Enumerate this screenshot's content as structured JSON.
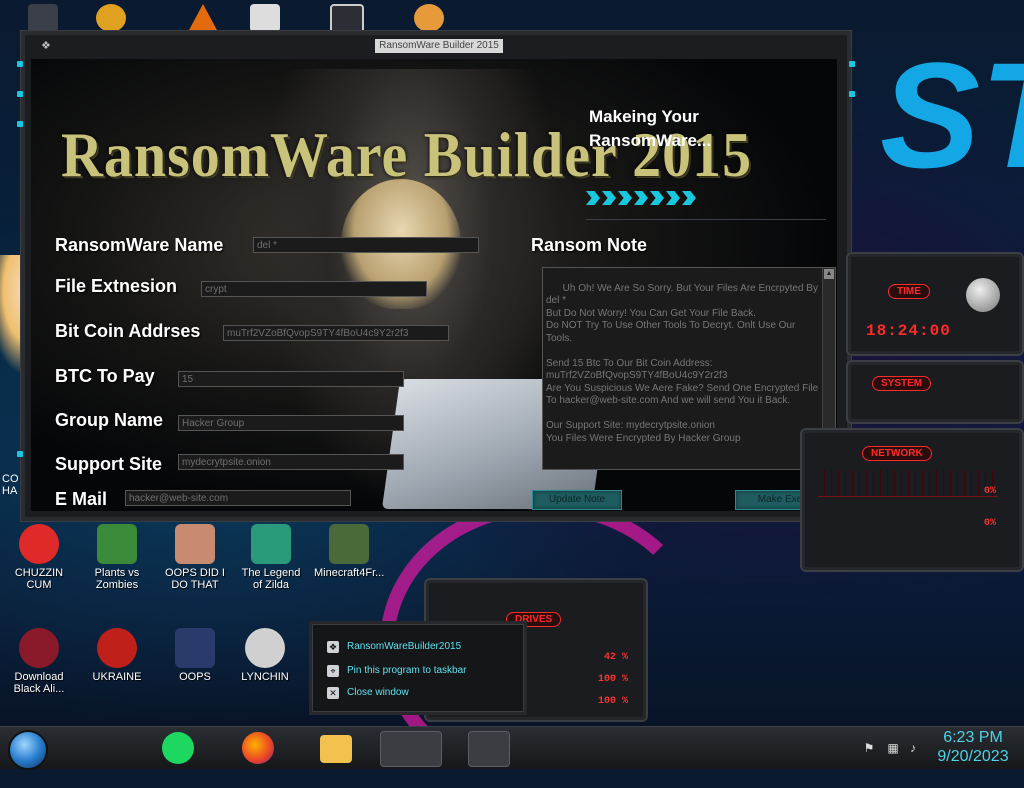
{
  "window": {
    "title": "RansomWare Builder 2015",
    "icon": "app-icon",
    "brand": "RansomWare Builder 2015",
    "status_line1": "Makeing Your",
    "status_line2": "RansomWare..."
  },
  "form": {
    "ransomware_name_label": "RansomWare Name",
    "ransomware_name_value": "del *",
    "file_extension_label": "File Extnesion",
    "file_extension_value": "crypt",
    "btc_address_label": "Bit Coin Addrses",
    "btc_address_value": "muTrf2VZoBfQvopS9TY4fBoU4c9Y2r2f3",
    "btc_pay_label": "BTC To Pay",
    "btc_pay_value": "15",
    "group_label": "Group Name",
    "group_value": "Hacker Group",
    "support_label": "Support Site",
    "support_value": "mydecrytpsite.onion",
    "email_label": "E Mail",
    "email_value": "hacker@web-site.com"
  },
  "note": {
    "label": "Ransom Note",
    "text": "Uh Oh! We Are So Sorry. But Your Files Are Encrpyted By del *\nBut Do Not Worry! You Can Get Your File Back.\nDo NOT Try To Use Other Tools To Decryt. Onlt Use Our Tools.\n\nSend 15 Btc To Our Bit Coin Address:\nmuTrf2VZoBfQvopS9TY4fBoU4c9Y2r2f3\nAre You Suspicious We Aere Fake? Send One Encrypted File To hacker@web-site.com And we will send You it Back.\n\nOur Support Site: mydecrytpsite.onion\nYou Files Were Encrypted By Hacker Group",
    "update_button": "Update Note",
    "make_button": "Make Exe"
  },
  "gadgets": {
    "time_label": "TIME",
    "time_value": "18:24:00",
    "system_label": "SYSTEM",
    "network_label": "NETWORK",
    "net_val1": "0%",
    "net_val2": "0%",
    "drives_label": "DRIVES",
    "drive_val1": "42 %",
    "drive_val2": "100 %",
    "drive_val3": "100 %"
  },
  "desktop_icons": [
    {
      "label": "CHUZZIN CUM",
      "color": "#e02a2a"
    },
    {
      "label": "Plants vs Zombies",
      "color": "#3a8a3a"
    },
    {
      "label": "OOPS DID I DO THAT",
      "color": "#c88a70"
    },
    {
      "label": "The Legend of Zilda",
      "color": "#2a9a7a"
    },
    {
      "label": "Minecraft4Fr...",
      "color": "#4a6a3a"
    },
    {
      "label": "Download Black Ali...",
      "color": "#8a1a2a"
    },
    {
      "label": "UKRAINE",
      "color": "#c0201a"
    },
    {
      "label": "OOPS",
      "color": "#2a3a6a"
    },
    {
      "label": "LYNCHIN",
      "color": "#d0d0d0"
    }
  ],
  "left_clip_text1": "CO",
  "left_clip_text2": "HA",
  "jumplist": {
    "app": "RansomWareBuilder2015",
    "pin": "Pin this program to taskbar",
    "close": "Close window"
  },
  "taskbar": {
    "time": "6:23 PM",
    "date": "9/20/2023"
  }
}
